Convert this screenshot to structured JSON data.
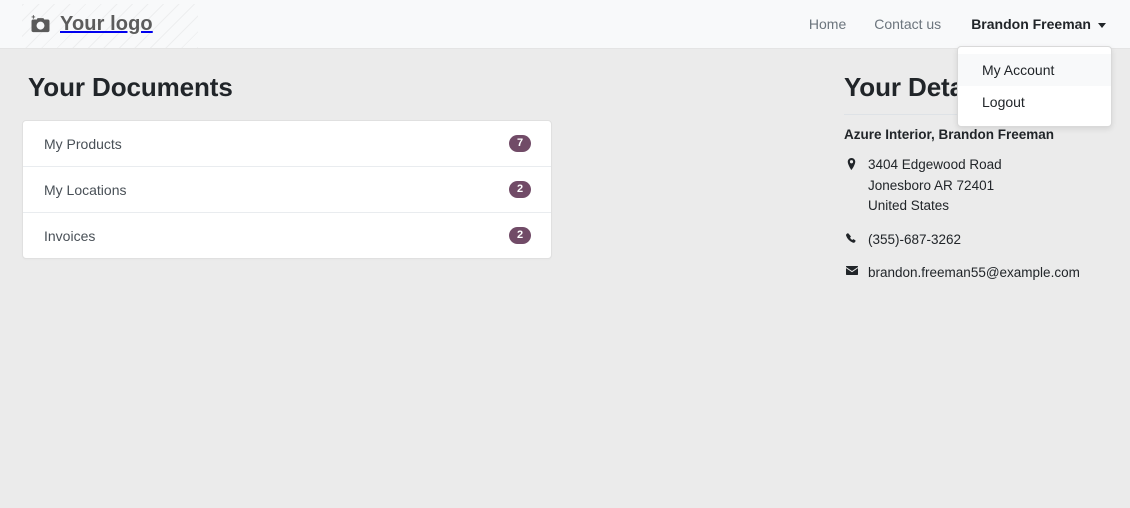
{
  "brand": {
    "logo_text": "Your logo",
    "logo_icon": "camera-add-icon"
  },
  "nav": {
    "links": [
      {
        "label": "Home",
        "name": "nav-link-home"
      },
      {
        "label": "Contact us",
        "name": "nav-link-contact-us"
      }
    ],
    "user": {
      "name": "Brandon Freeman",
      "caret_icon": "chevron-down-icon",
      "menu": [
        {
          "label": "My Account",
          "active": true
        },
        {
          "label": "Logout",
          "active": false
        }
      ]
    }
  },
  "documents": {
    "title": "Your Documents",
    "items": [
      {
        "label": "My Products",
        "count": "7"
      },
      {
        "label": "My Locations",
        "count": "2"
      },
      {
        "label": "Invoices",
        "count": "2"
      }
    ]
  },
  "details": {
    "title": "Your Details",
    "contact_name": "Azure Interior, Brandon Freeman",
    "address": {
      "icon": "map-marker-icon",
      "line1": "3404 Edgewood Road",
      "line2": "Jonesboro AR 72401",
      "line3": "United States"
    },
    "phone": {
      "icon": "phone-icon",
      "value": "(355)-687-3262"
    },
    "email": {
      "icon": "envelope-icon",
      "value": "brandon.freeman55@example.com"
    }
  },
  "colors": {
    "badge": "#714b67",
    "page_background": "#ebebeb",
    "navbar_background": "#f8f9fa",
    "card_background": "#ffffff",
    "muted_text": "#6c757d"
  }
}
